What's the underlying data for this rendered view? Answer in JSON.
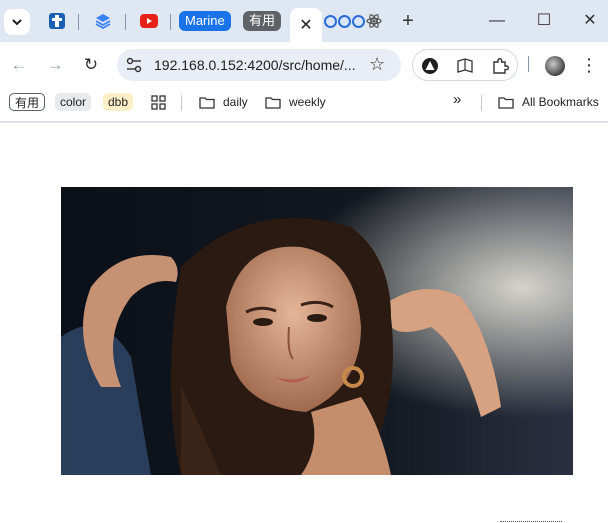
{
  "tabs": {
    "marine_label": "Marine",
    "youyong_label": "有用",
    "active_close": "✕",
    "new_tab": "+"
  },
  "window": {
    "minimize": "—",
    "maximize": "☐",
    "close": "✕"
  },
  "toolbar": {
    "back": "←",
    "forward": "→",
    "reload": "↻",
    "url": "192.168.0.152:4200/src/home/...",
    "star": "☆",
    "menu": "⋮"
  },
  "bookmarks": {
    "chip_youyong": "有用",
    "chip_color": "color",
    "chip_dbb": "dbb",
    "folder_daily": "daily",
    "folder_weekly": "weekly",
    "overflow": "»",
    "all_bookmarks": "All Bookmarks"
  },
  "colors": {
    "marine_tab": "#1a73e8",
    "youyong_tab": "#5f6368",
    "youtube_red": "#e62117",
    "chrome_bg": "#dfe7f3",
    "chip_color_bg": "#e8eaed",
    "chip_dbb_bg": "#fdf0c8"
  },
  "icons": {
    "tab_search": "chevron-down-icon",
    "photo": "portrait-photo"
  }
}
